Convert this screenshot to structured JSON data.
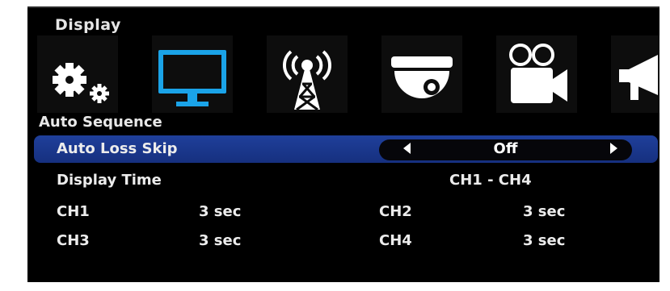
{
  "menu": {
    "title": "Display",
    "icons": [
      {
        "name": "settings-gears-icon",
        "selected": false
      },
      {
        "name": "monitor-icon",
        "selected": true
      },
      {
        "name": "antenna-tower-icon",
        "selected": false
      },
      {
        "name": "dome-camera-icon",
        "selected": false
      },
      {
        "name": "video-camera-icon",
        "selected": false
      },
      {
        "name": "megaphone-icon",
        "selected": false
      }
    ]
  },
  "section": {
    "title": "Auto Sequence"
  },
  "auto_loss_skip": {
    "label": "Auto Loss Skip",
    "value": "Off"
  },
  "display_time": {
    "label": "Display Time",
    "range": "CH1 - CH4"
  },
  "channels": [
    {
      "name": "CH1",
      "value": "3 sec"
    },
    {
      "name": "CH2",
      "value": "3 sec"
    },
    {
      "name": "CH3",
      "value": "3 sec"
    },
    {
      "name": "CH4",
      "value": "3 sec"
    }
  ],
  "colors": {
    "selected_row": "#1f3f9a",
    "selected_icon": "#1aa3e8",
    "icon": "#ffffff",
    "background": "#000000"
  }
}
